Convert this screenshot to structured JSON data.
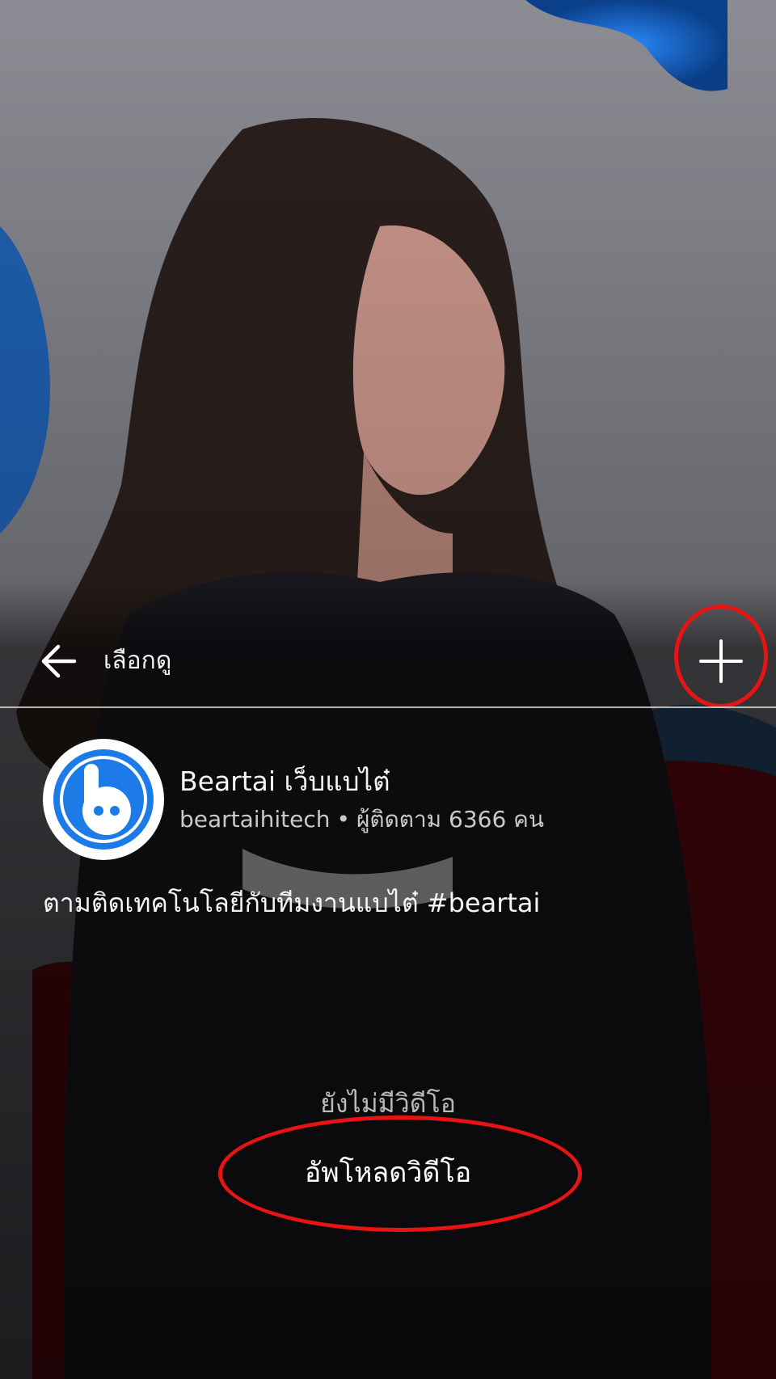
{
  "topbar": {
    "back_icon": "arrow-left-icon",
    "title": "เลือกดู",
    "add_icon": "plus-icon"
  },
  "channel": {
    "avatar_icon": "beartai-logo",
    "name": "Beartai เว็บแบไต๋",
    "handle": "beartaihitech",
    "separator": "•",
    "followers_text": "ผู้ติดตาม 6366 คน",
    "description": "ตามติดเทคโนโลยีกับทีมงานแบไต๋ #beartai"
  },
  "empty_state": {
    "message": "ยังไม่มีวิดีโอ",
    "upload_label": "อัพโหลดวิดีโอ"
  },
  "colors": {
    "annotation_red": "#e81313",
    "brand_blue": "#1d7be8"
  }
}
